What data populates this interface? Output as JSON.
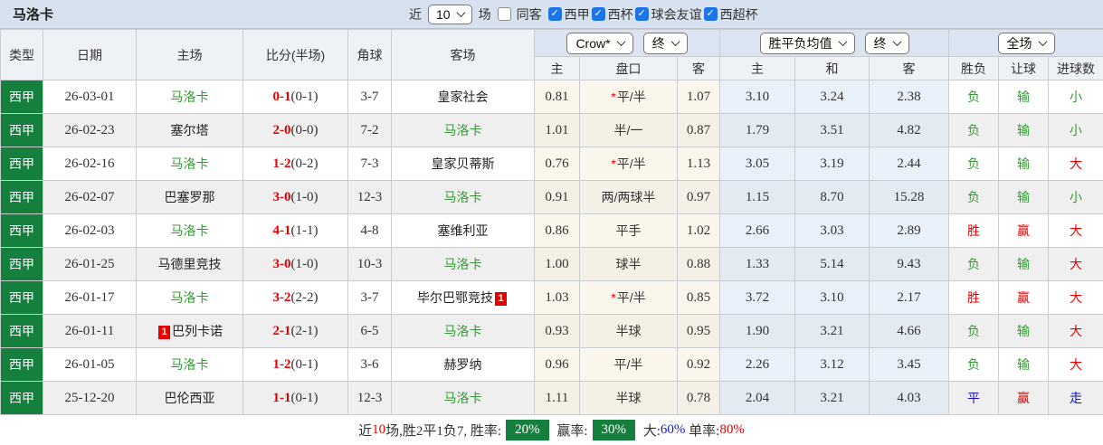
{
  "title": "马洛卡",
  "controls": {
    "recent_label": "近",
    "recent_value": "10",
    "matches_label": "场",
    "same_venue_label": "同客",
    "same_venue_checked": false,
    "league_filters": [
      {
        "label": "西甲",
        "checked": true
      },
      {
        "label": "西杯",
        "checked": true
      },
      {
        "label": "球会友谊",
        "checked": true
      },
      {
        "label": "西超杯",
        "checked": true
      }
    ]
  },
  "header": {
    "col_type": "类型",
    "col_date": "日期",
    "col_home": "主场",
    "col_score": "比分(半场)",
    "col_corner": "角球",
    "col_away": "客场",
    "odds_select": "Crow*",
    "odds_time_select": "终",
    "avg_select": "胜平负均值",
    "avg_time_select": "终",
    "scope_select": "全场",
    "sub": {
      "home": "主",
      "handicap": "盘口",
      "away": "客",
      "avg_home": "主",
      "avg_draw": "和",
      "avg_away": "客",
      "result": "胜负",
      "handicap_result": "让球",
      "goals": "进球数"
    }
  },
  "rows": [
    {
      "league": "西甲",
      "date": "26-03-01",
      "home": "马洛卡",
      "home_is_target": true,
      "home_badge": "",
      "score": "0-1",
      "half": "(0-1)",
      "corner": "3-7",
      "away": "皇家社会",
      "away_is_target": false,
      "away_badge": "",
      "odds_home": "0.81",
      "handicap_prefix": "*",
      "handicap": "平/半",
      "odds_away": "1.07",
      "avg_home": "3.10",
      "avg_draw": "3.24",
      "avg_away": "2.38",
      "result": "负",
      "result_color": "green",
      "handicap_result": "输",
      "handicap_result_color": "green",
      "goals": "小",
      "goals_color": "green"
    },
    {
      "league": "西甲",
      "date": "26-02-23",
      "home": "塞尔塔",
      "home_is_target": false,
      "home_badge": "",
      "score": "2-0",
      "half": "(0-0)",
      "corner": "7-2",
      "away": "马洛卡",
      "away_is_target": true,
      "away_badge": "",
      "odds_home": "1.01",
      "handicap_prefix": "",
      "handicap": "半/一",
      "odds_away": "0.87",
      "avg_home": "1.79",
      "avg_draw": "3.51",
      "avg_away": "4.82",
      "result": "负",
      "result_color": "green",
      "handicap_result": "输",
      "handicap_result_color": "green",
      "goals": "小",
      "goals_color": "green"
    },
    {
      "league": "西甲",
      "date": "26-02-16",
      "home": "马洛卡",
      "home_is_target": true,
      "home_badge": "",
      "score": "1-2",
      "half": "(0-2)",
      "corner": "7-3",
      "away": "皇家贝蒂斯",
      "away_is_target": false,
      "away_badge": "",
      "odds_home": "0.76",
      "handicap_prefix": "*",
      "handicap": "平/半",
      "odds_away": "1.13",
      "avg_home": "3.05",
      "avg_draw": "3.19",
      "avg_away": "2.44",
      "result": "负",
      "result_color": "green",
      "handicap_result": "输",
      "handicap_result_color": "green",
      "goals": "大",
      "goals_color": "red"
    },
    {
      "league": "西甲",
      "date": "26-02-07",
      "home": "巴塞罗那",
      "home_is_target": false,
      "home_badge": "",
      "score": "3-0",
      "half": "(1-0)",
      "corner": "12-3",
      "away": "马洛卡",
      "away_is_target": true,
      "away_badge": "",
      "odds_home": "0.91",
      "handicap_prefix": "",
      "handicap": "两/两球半",
      "odds_away": "0.97",
      "avg_home": "1.15",
      "avg_draw": "8.70",
      "avg_away": "15.28",
      "result": "负",
      "result_color": "green",
      "handicap_result": "输",
      "handicap_result_color": "green",
      "goals": "小",
      "goals_color": "green"
    },
    {
      "league": "西甲",
      "date": "26-02-03",
      "home": "马洛卡",
      "home_is_target": true,
      "home_badge": "",
      "score": "4-1",
      "half": "(1-1)",
      "corner": "4-8",
      "away": "塞维利亚",
      "away_is_target": false,
      "away_badge": "",
      "odds_home": "0.86",
      "handicap_prefix": "",
      "handicap": "平手",
      "odds_away": "1.02",
      "avg_home": "2.66",
      "avg_draw": "3.03",
      "avg_away": "2.89",
      "result": "胜",
      "result_color": "red",
      "handicap_result": "赢",
      "handicap_result_color": "red",
      "goals": "大",
      "goals_color": "red"
    },
    {
      "league": "西甲",
      "date": "26-01-25",
      "home": "马德里竞技",
      "home_is_target": false,
      "home_badge": "",
      "score": "3-0",
      "half": "(1-0)",
      "corner": "10-3",
      "away": "马洛卡",
      "away_is_target": true,
      "away_badge": "",
      "odds_home": "1.00",
      "handicap_prefix": "",
      "handicap": "球半",
      "odds_away": "0.88",
      "avg_home": "1.33",
      "avg_draw": "5.14",
      "avg_away": "9.43",
      "result": "负",
      "result_color": "green",
      "handicap_result": "输",
      "handicap_result_color": "green",
      "goals": "大",
      "goals_color": "red"
    },
    {
      "league": "西甲",
      "date": "26-01-17",
      "home": "马洛卡",
      "home_is_target": true,
      "home_badge": "",
      "score": "3-2",
      "half": "(2-2)",
      "corner": "3-7",
      "away": "毕尔巴鄂竞技",
      "away_is_target": false,
      "away_badge": "1",
      "odds_home": "1.03",
      "handicap_prefix": "*",
      "handicap": "平/半",
      "odds_away": "0.85",
      "avg_home": "3.72",
      "avg_draw": "3.10",
      "avg_away": "2.17",
      "result": "胜",
      "result_color": "red",
      "handicap_result": "赢",
      "handicap_result_color": "red",
      "goals": "大",
      "goals_color": "red"
    },
    {
      "league": "西甲",
      "date": "26-01-11",
      "home": "巴列卡诺",
      "home_is_target": false,
      "home_badge": "1",
      "score": "2-1",
      "half": "(2-1)",
      "corner": "6-5",
      "away": "马洛卡",
      "away_is_target": true,
      "away_badge": "",
      "odds_home": "0.93",
      "handicap_prefix": "",
      "handicap": "半球",
      "odds_away": "0.95",
      "avg_home": "1.90",
      "avg_draw": "3.21",
      "avg_away": "4.66",
      "result": "负",
      "result_color": "green",
      "handicap_result": "输",
      "handicap_result_color": "green",
      "goals": "大",
      "goals_color": "red"
    },
    {
      "league": "西甲",
      "date": "26-01-05",
      "home": "马洛卡",
      "home_is_target": true,
      "home_badge": "",
      "score": "1-2",
      "half": "(0-1)",
      "corner": "3-6",
      "away": "赫罗纳",
      "away_is_target": false,
      "away_badge": "",
      "odds_home": "0.96",
      "handicap_prefix": "",
      "handicap": "平/半",
      "odds_away": "0.92",
      "avg_home": "2.26",
      "avg_draw": "3.12",
      "avg_away": "3.45",
      "result": "负",
      "result_color": "green",
      "handicap_result": "输",
      "handicap_result_color": "green",
      "goals": "大",
      "goals_color": "red"
    },
    {
      "league": "西甲",
      "date": "25-12-20",
      "home": "巴伦西亚",
      "home_is_target": false,
      "home_badge": "",
      "score": "1-1",
      "half": "(0-1)",
      "corner": "12-3",
      "away": "马洛卡",
      "away_is_target": true,
      "away_badge": "",
      "odds_home": "1.11",
      "handicap_prefix": "",
      "handicap": "半球",
      "odds_away": "0.78",
      "avg_home": "2.04",
      "avg_draw": "3.21",
      "avg_away": "4.03",
      "result": "平",
      "result_color": "blue",
      "handicap_result": "赢",
      "handicap_result_color": "red",
      "goals": "走",
      "goals_color": "blue"
    }
  ],
  "summary": {
    "parts": [
      {
        "text": "近",
        "style": "plain"
      },
      {
        "text": "10",
        "style": "red"
      },
      {
        "text": "场,胜2平1负7, 胜率:",
        "style": "plain"
      },
      {
        "text": "20%",
        "style": "badge"
      },
      {
        "text": " 赢率:",
        "style": "plain"
      },
      {
        "text": "30%",
        "style": "badge"
      },
      {
        "text": " 大:",
        "style": "plain"
      },
      {
        "text": "60%",
        "style": "blue"
      },
      {
        "text": " 单率:",
        "style": "plain"
      },
      {
        "text": "80%",
        "style": "red"
      }
    ]
  },
  "colors": {
    "league_badge_green": "#15803d",
    "target_team_green": "#339933",
    "loss_green": "#339933",
    "win_red": "#e60000",
    "draw_blue": "#1616c9",
    "checkbox_blue": "#1b74e8",
    "odds_column_cream": "#fbf6ec",
    "avg_column_blue": "#e8f1fa",
    "alt_row_gray": "#efefef",
    "topbar_bg": "#d8e1ef",
    "summary_badge_green": "#15803d"
  }
}
